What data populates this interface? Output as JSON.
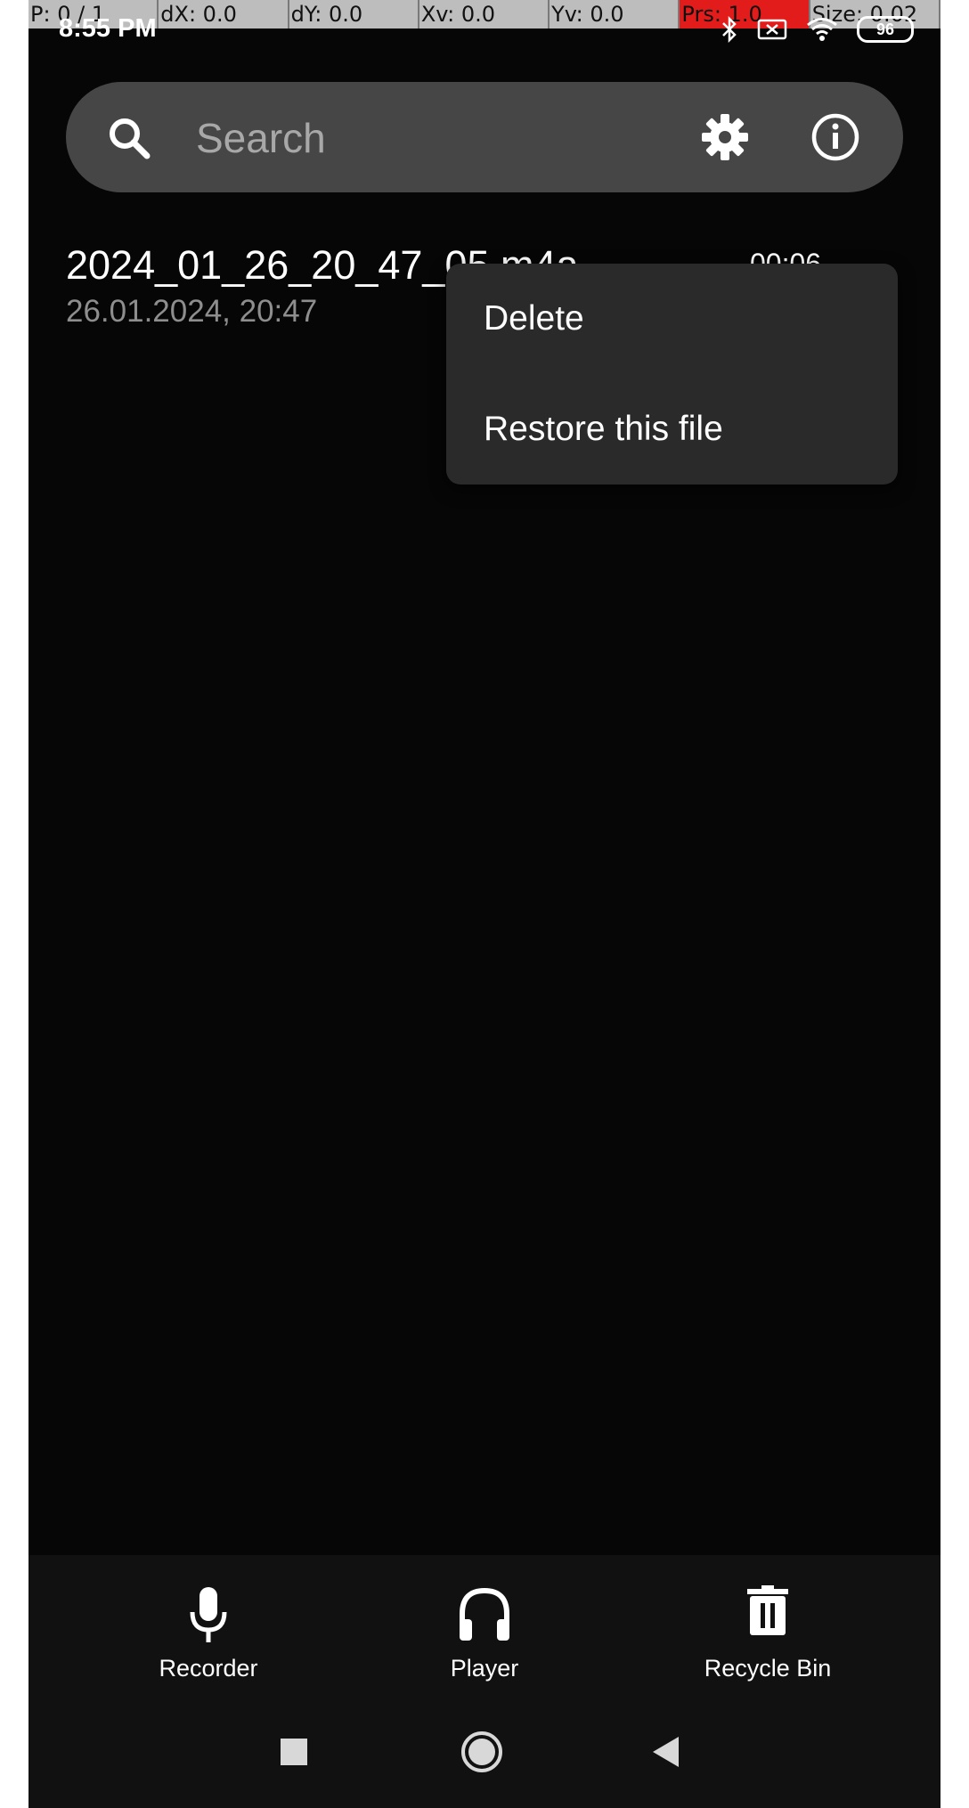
{
  "debug_overlay": {
    "cells": [
      "P: 0 / 1",
      "dX: 0.0",
      "dY: 0.0",
      "Xv: 0.0",
      "Yv: 0.0",
      "Prs: 1.0",
      "Size: 0.02"
    ],
    "highlight_color": "#e21b1b"
  },
  "status_bar": {
    "time": "8:55 PM",
    "icons": [
      "bluetooth-icon",
      "screen-cast-icon",
      "wifi-icon",
      "battery-icon"
    ],
    "battery": "96"
  },
  "search": {
    "placeholder": "Search",
    "value": ""
  },
  "recordings": [
    {
      "name": "2024_01_26_20_47_05.m4a",
      "date": "26.01.2024, 20:47",
      "duration": "00:06"
    }
  ],
  "context_menu": {
    "items": [
      {
        "label": "Delete"
      },
      {
        "label": "Restore this file"
      }
    ]
  },
  "bottom_nav": {
    "tabs": [
      {
        "label": "Recorder",
        "icon": "microphone-icon"
      },
      {
        "label": "Player",
        "icon": "headphones-icon"
      },
      {
        "label": "Recycle Bin",
        "icon": "trash-icon"
      }
    ]
  },
  "system_nav": {
    "buttons": [
      "recents-square-icon",
      "home-circle-icon",
      "back-triangle-icon"
    ]
  },
  "colors": {
    "background": "#060606",
    "search_bar": "#464646",
    "menu_background": "#2a2a2a",
    "nav_background": "#111111",
    "secondary_text": "#8e8e8e"
  }
}
